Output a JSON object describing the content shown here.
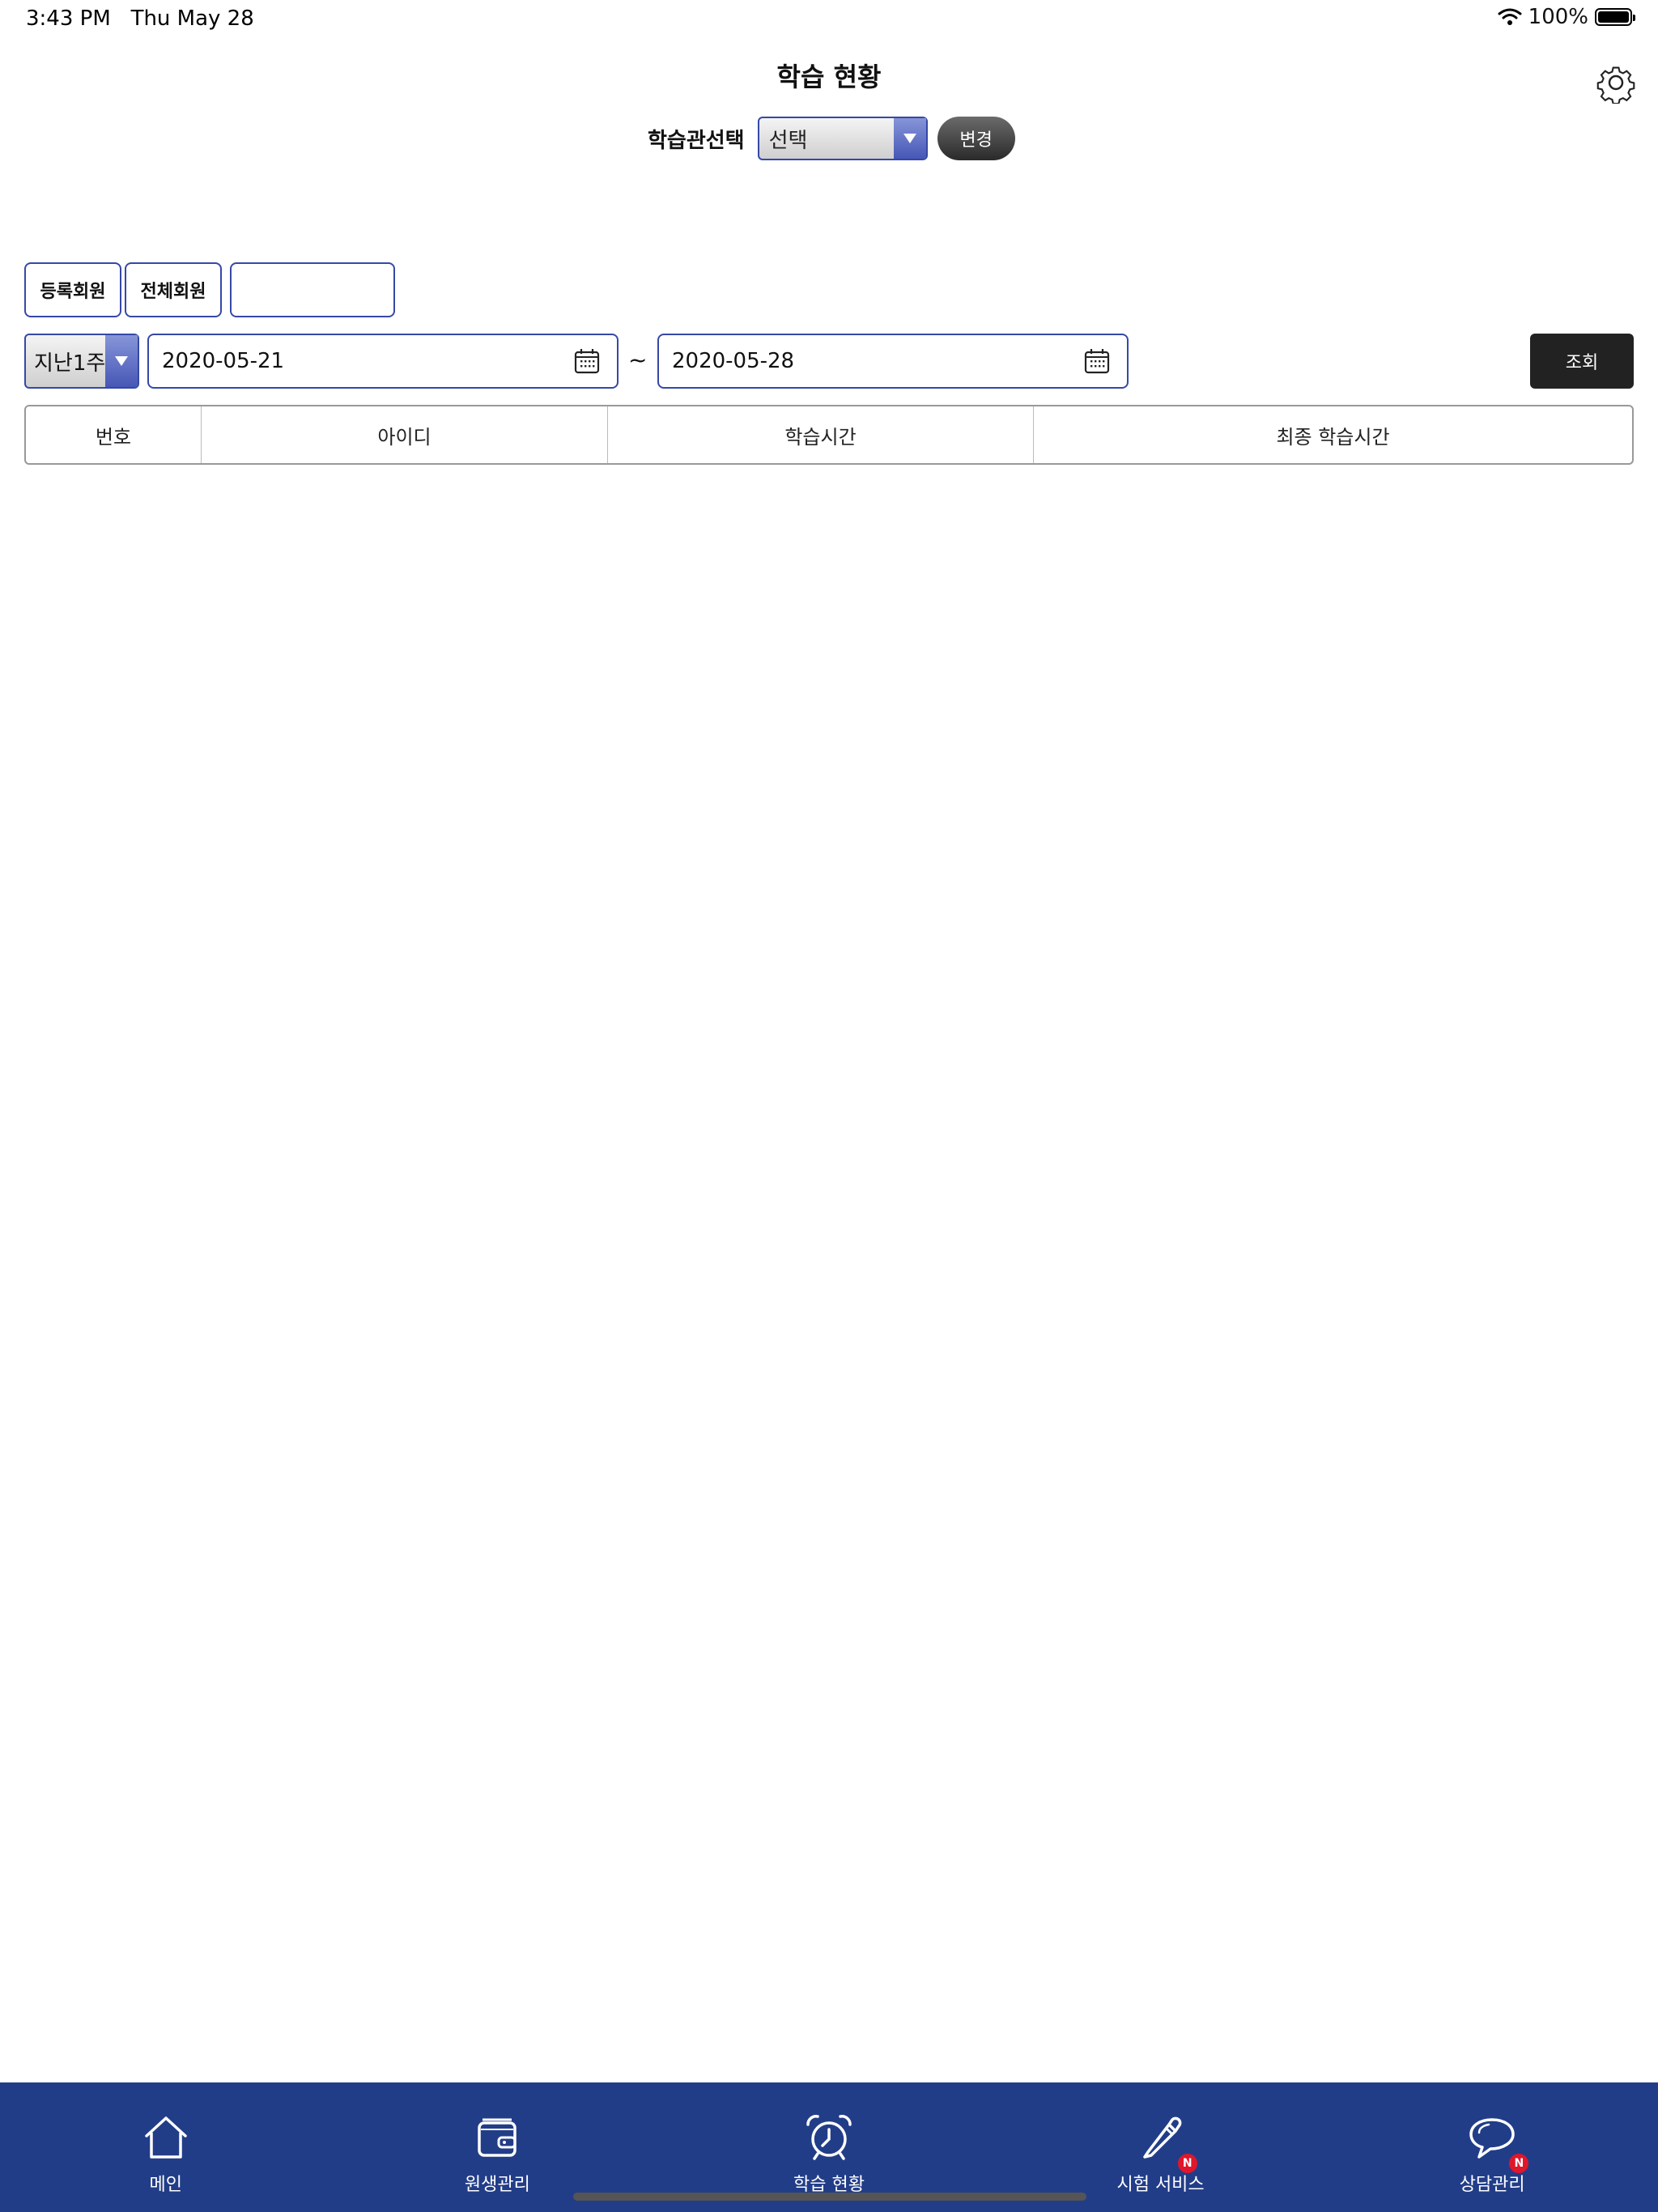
{
  "status_bar": {
    "time": "3:43 PM",
    "date": "Thu May 28",
    "battery": "100%"
  },
  "header": {
    "title": "학습 현황"
  },
  "branch": {
    "label": "학습관선택",
    "selected": "선택",
    "change_label": "변경"
  },
  "filters": {
    "registered_label": "등록회원",
    "all_label": "전체회원",
    "search_value": ""
  },
  "date_range": {
    "period": "지난1주",
    "start": "2020-05-21",
    "separator": "~",
    "end": "2020-05-28",
    "query_label": "조회"
  },
  "table": {
    "columns": [
      "번호",
      "아이디",
      "학습시간",
      "최종 학습시간"
    ]
  },
  "tab_bar": {
    "items": [
      {
        "label": "메인",
        "icon": "home-icon"
      },
      {
        "label": "원생관리",
        "icon": "wallet-icon"
      },
      {
        "label": "학습 현황",
        "icon": "alarm-clock-icon"
      },
      {
        "label": "시험 서비스",
        "icon": "pencil-icon",
        "badge": "N"
      },
      {
        "label": "상담관리",
        "icon": "speech-bubble-icon",
        "badge": "N"
      }
    ],
    "background": "#223d88",
    "badge_color": "#e0162b"
  },
  "colors": {
    "accent": "#3648a6",
    "query_button": "#222222"
  }
}
